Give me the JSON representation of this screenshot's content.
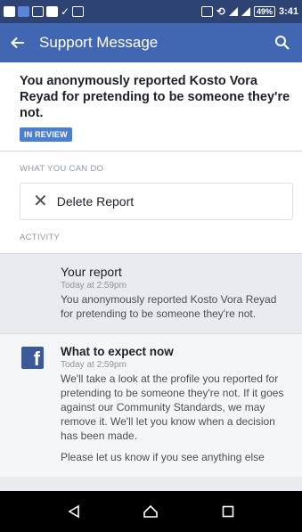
{
  "status_bar": {
    "battery": "49%",
    "time": "3:41"
  },
  "app_bar": {
    "title": "Support Message",
    "back_icon": "arrow-left-icon",
    "search_icon": "search-icon"
  },
  "report": {
    "title": "You anonymously reported Kosto Vora Reyad for pretending to be someone they're not.",
    "status_badge": "IN REVIEW"
  },
  "actions": {
    "section_label": "WHAT YOU CAN DO",
    "delete_label": "Delete Report"
  },
  "activity": {
    "section_label": "ACTIVITY",
    "items": [
      {
        "title": "Your report",
        "time": "Today at 2:59pm",
        "body": "You anonymously reported Kosto Vora Reyad for pretending to be someone they're not."
      },
      {
        "title": "What to expect now",
        "time": "Today at 2:59pm",
        "body": "We'll take a look at the profile you reported for pretending to be someone they're not. If it goes against our Community Standards, we may remove it. We'll let you know when a decision has been made.",
        "body2": "Please let us know if you see anything else"
      }
    ]
  },
  "colors": {
    "status_bar": "#2d4373",
    "app_bar": "#4267b2",
    "badge": "#4a7fd1",
    "nav_bar": "#000000"
  }
}
